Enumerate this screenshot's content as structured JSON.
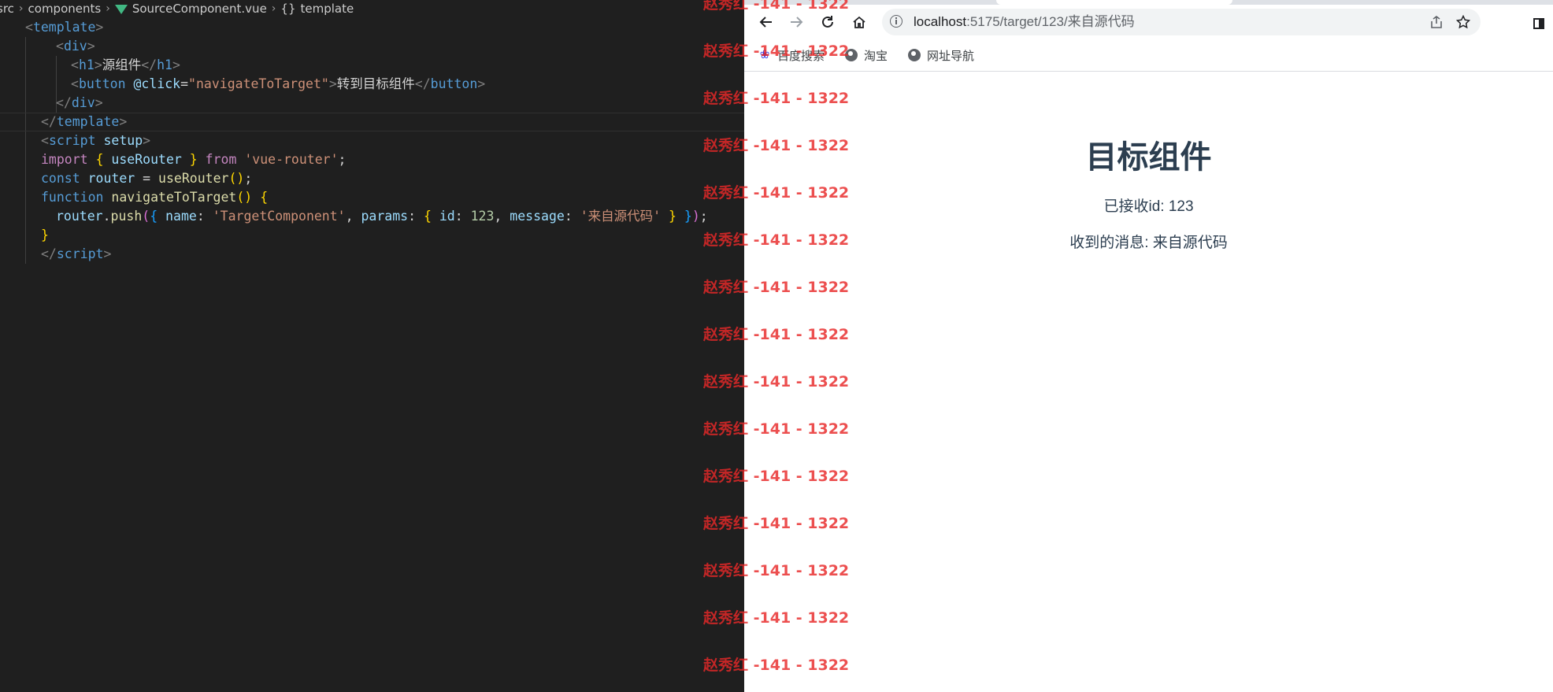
{
  "editor": {
    "breadcrumb": {
      "folder1": "src",
      "folder2": "components",
      "file": "SourceComponent.vue",
      "symbol": "template"
    },
    "lines": [
      [
        [
          "tk-tag",
          "<"
        ],
        [
          "tk-name",
          "template"
        ],
        [
          "tk-tag",
          ">"
        ]
      ],
      [
        [
          "tk-tag",
          "<"
        ],
        [
          "tk-name",
          "div"
        ],
        [
          "tk-tag",
          ">"
        ]
      ],
      [
        [
          "tk-tag",
          "<"
        ],
        [
          "tk-name",
          "h1"
        ],
        [
          "tk-tag",
          ">"
        ],
        [
          "tk-txt",
          "源组件"
        ],
        [
          "tk-tag",
          "</"
        ],
        [
          "tk-name",
          "h1"
        ],
        [
          "tk-tag",
          ">"
        ]
      ],
      [
        [
          "tk-tag",
          "<"
        ],
        [
          "tk-name",
          "button"
        ],
        [
          "tk-txt",
          " "
        ],
        [
          "tk-attr",
          "@click"
        ],
        [
          "tk-txt",
          "="
        ],
        [
          "tk-str",
          "\"navigateToTarget\""
        ],
        [
          "tk-tag",
          ">"
        ],
        [
          "tk-txt",
          "转到目标组件"
        ],
        [
          "tk-tag",
          "</"
        ],
        [
          "tk-name",
          "button"
        ],
        [
          "tk-tag",
          ">"
        ]
      ],
      [
        [
          "tk-tag",
          "</"
        ],
        [
          "tk-name",
          "div"
        ],
        [
          "tk-tag",
          ">"
        ]
      ],
      [
        [
          "tk-tag",
          "</"
        ],
        [
          "tk-name",
          "template"
        ],
        [
          "tk-tag",
          ">"
        ]
      ],
      [
        [
          "tk-tag",
          "<"
        ],
        [
          "tk-name",
          "script"
        ],
        [
          "tk-txt",
          " "
        ],
        [
          "tk-attr",
          "setup"
        ],
        [
          "tk-tag",
          ">"
        ]
      ],
      [
        [
          "tk-kw",
          "import"
        ],
        [
          "tk-txt",
          " "
        ],
        [
          "tk-br1",
          "{"
        ],
        [
          "tk-txt",
          " "
        ],
        [
          "tk-var",
          "useRouter"
        ],
        [
          "tk-txt",
          " "
        ],
        [
          "tk-br1",
          "}"
        ],
        [
          "tk-txt",
          " "
        ],
        [
          "tk-kw",
          "from"
        ],
        [
          "tk-txt",
          " "
        ],
        [
          "tk-str",
          "'vue-router'"
        ],
        [
          "tk-txt",
          ";"
        ]
      ],
      [
        [
          "tk-decl",
          "const"
        ],
        [
          "tk-txt",
          " "
        ],
        [
          "tk-var",
          "router"
        ],
        [
          "tk-txt",
          " = "
        ],
        [
          "tk-fn",
          "useRouter"
        ],
        [
          "tk-br1",
          "()"
        ],
        [
          "tk-txt",
          ";"
        ]
      ],
      [
        [
          "tk-decl",
          "function"
        ],
        [
          "tk-txt",
          " "
        ],
        [
          "tk-fn",
          "navigateToTarget"
        ],
        [
          "tk-br1",
          "()"
        ],
        [
          "tk-txt",
          " "
        ],
        [
          "tk-br1",
          "{"
        ]
      ],
      [
        [
          "tk-var",
          "router"
        ],
        [
          "tk-txt",
          "."
        ],
        [
          "tk-fn",
          "push"
        ],
        [
          "tk-br2",
          "("
        ],
        [
          "tk-br3",
          "{"
        ],
        [
          "tk-txt",
          " "
        ],
        [
          "tk-var",
          "name"
        ],
        [
          "tk-txt",
          ": "
        ],
        [
          "tk-str",
          "'TargetComponent'"
        ],
        [
          "tk-txt",
          ", "
        ],
        [
          "tk-var",
          "params"
        ],
        [
          "tk-txt",
          ": "
        ],
        [
          "tk-br1",
          "{"
        ],
        [
          "tk-txt",
          " "
        ],
        [
          "tk-var",
          "id"
        ],
        [
          "tk-txt",
          ": "
        ],
        [
          "tk-num",
          "123"
        ],
        [
          "tk-txt",
          ", "
        ],
        [
          "tk-var",
          "message"
        ],
        [
          "tk-txt",
          ": "
        ],
        [
          "tk-str",
          "'来自源代码'"
        ],
        [
          "tk-txt",
          " "
        ],
        [
          "tk-br1",
          "}"
        ],
        [
          "tk-txt",
          " "
        ],
        [
          "tk-br3",
          "}"
        ],
        [
          "tk-br2",
          ")"
        ],
        [
          "tk-txt",
          ";"
        ]
      ],
      [
        [
          "tk-br1",
          "}"
        ]
      ],
      [
        [
          "tk-tag",
          "</"
        ],
        [
          "tk-name",
          "script"
        ],
        [
          "tk-tag",
          ">"
        ]
      ]
    ]
  },
  "browser": {
    "url_host": "localhost",
    "url_path": ":5175/target/123/来自源代码",
    "bookmarks": [
      "百度搜索",
      "淘宝",
      "网址导航"
    ],
    "page": {
      "title": "目标组件",
      "id_line": "已接收id: 123",
      "message_line": "收到的消息: 来自源代码"
    }
  },
  "watermark": {
    "text": "赵秀红 -141 - 1322",
    "count": 15
  },
  "icons": {
    "back": "arrow-back-icon",
    "forward": "arrow-forward-icon",
    "reload": "reload-icon",
    "home": "home-icon",
    "share": "share-icon",
    "bookmark_star": "star-icon",
    "side_panel": "side-panel-icon",
    "site_info": "info-icon"
  }
}
